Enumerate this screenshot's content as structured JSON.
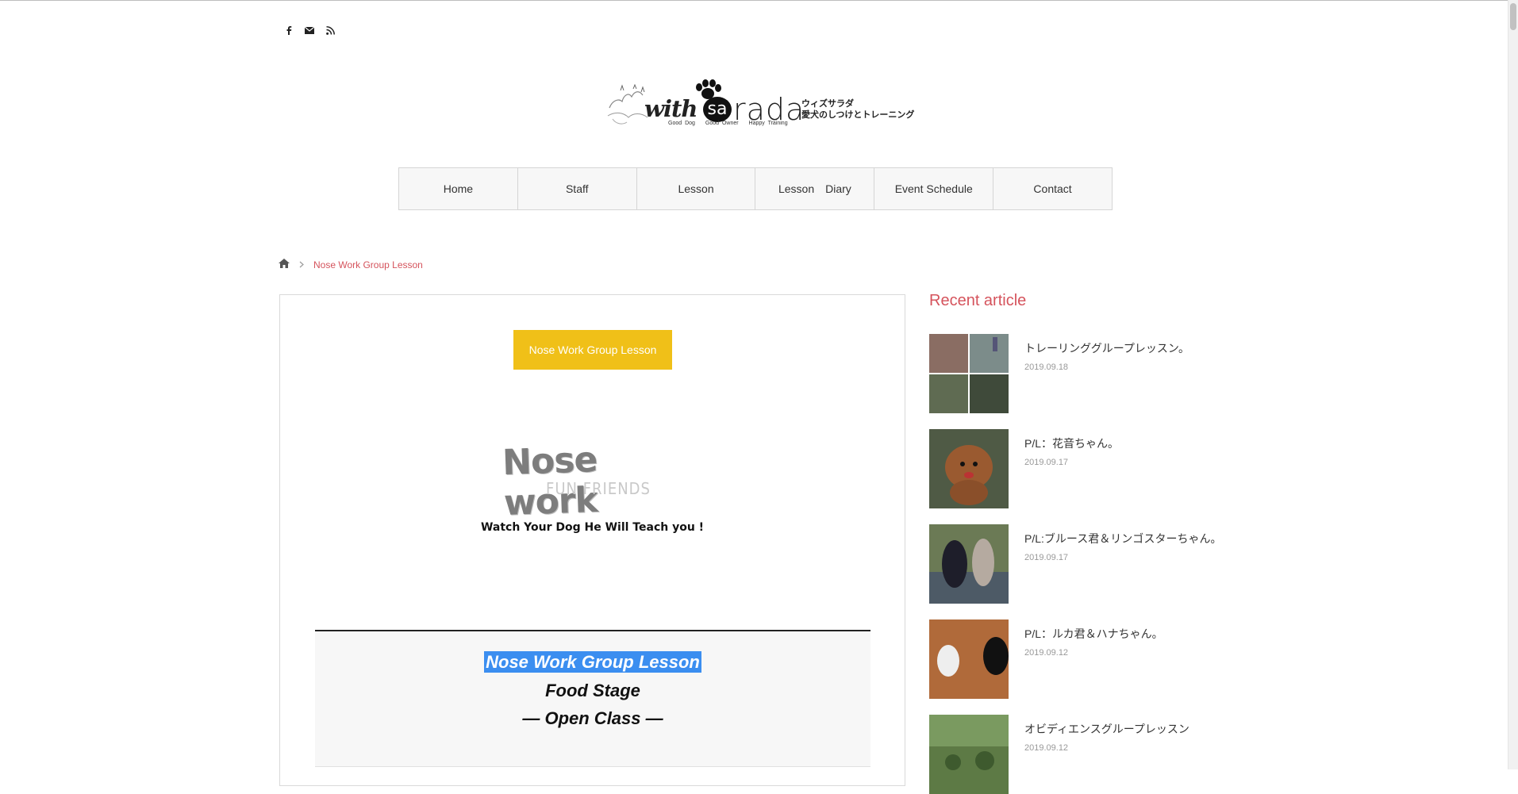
{
  "social": {
    "facebook": "f",
    "mail": "mail-icon",
    "rss": "rss-icon"
  },
  "logo": {
    "brand_prefix": "with",
    "brand_mark": "sa",
    "brand_suffix": "rada",
    "jp_name": "ウィズサラダ",
    "jp_tagline": "愛犬のしつけとトレーニング",
    "sub_good_dog": "Good Dog",
    "sub_good_owner": "Good Owner",
    "sub_happy_training": "Happy Training"
  },
  "nav": {
    "items": [
      "Home",
      "Staff",
      "Lesson",
      "Lesson　Diary",
      "Event Schedule",
      "Contact"
    ]
  },
  "breadcrumb": {
    "current": "Nose Work Group Lesson"
  },
  "main": {
    "title_button": "Nose Work Group Lesson",
    "logo_text": "Nose work",
    "logo_sub": "FUN FRIENDS",
    "tagline": "Watch Your Dog He Will Teach you !",
    "box_line1": "Nose Work Group Lesson",
    "box_line2": "Food Stage",
    "box_line3": "— Open Class —"
  },
  "sidebar": {
    "heading": "Recent article",
    "articles": [
      {
        "title": "トレーリンググループレッスン。",
        "date": "2019.09.18"
      },
      {
        "title": "P/L：花音ちゃん。",
        "date": "2019.09.17"
      },
      {
        "title": "P/L:ブルース君＆リンゴスターちゃん。",
        "date": "2019.09.17"
      },
      {
        "title": "P/L：ルカ君＆ハナちゃん。",
        "date": "2019.09.12"
      },
      {
        "title": "オビディエンスグループレッスン",
        "date": "2019.09.12"
      }
    ]
  },
  "colors": {
    "accent": "#d5535c",
    "button": "#f0c018",
    "highlight": "#3b8ef0"
  }
}
